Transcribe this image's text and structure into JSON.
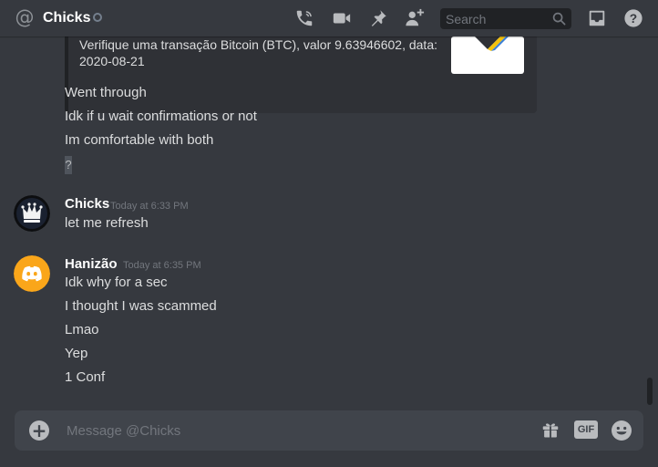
{
  "header": {
    "channel_name": "Chicks",
    "search_placeholder": "Search",
    "icons": [
      "at-icon",
      "status-dot",
      "phone-call-icon",
      "video-call-icon",
      "pin-icon",
      "add-friend-icon",
      "search-icon",
      "inbox-icon",
      "help-icon"
    ]
  },
  "embed": {
    "description": "Verifique uma transação Bitcoin (BTC), valor 9.63946602, data:\n2020-08-21"
  },
  "messages": {
    "continuation": [
      "Went through",
      "Idk if u wait confirmations or not",
      "Im comfortable with both"
    ],
    "unknown_emoji": "?",
    "groups": [
      {
        "author": "Chicks",
        "timestamp": "Today at 6:33 PM",
        "lines": [
          "let me refresh"
        ]
      },
      {
        "author": "Hanizão",
        "timestamp": "Today at 6:35 PM",
        "lines": [
          "Idk why for a sec",
          "I thought I was scammed",
          "Lmao",
          "Yep",
          "1 Conf"
        ]
      }
    ]
  },
  "composer": {
    "placeholder": "Message @Chicks",
    "gif_label": "GIF"
  },
  "colors": {
    "background": "#36393f",
    "composer": "#40444b",
    "search": "#202225",
    "discord_avatar": "#faa61a",
    "text": "#dcddde",
    "timestamp": "#72767d"
  }
}
